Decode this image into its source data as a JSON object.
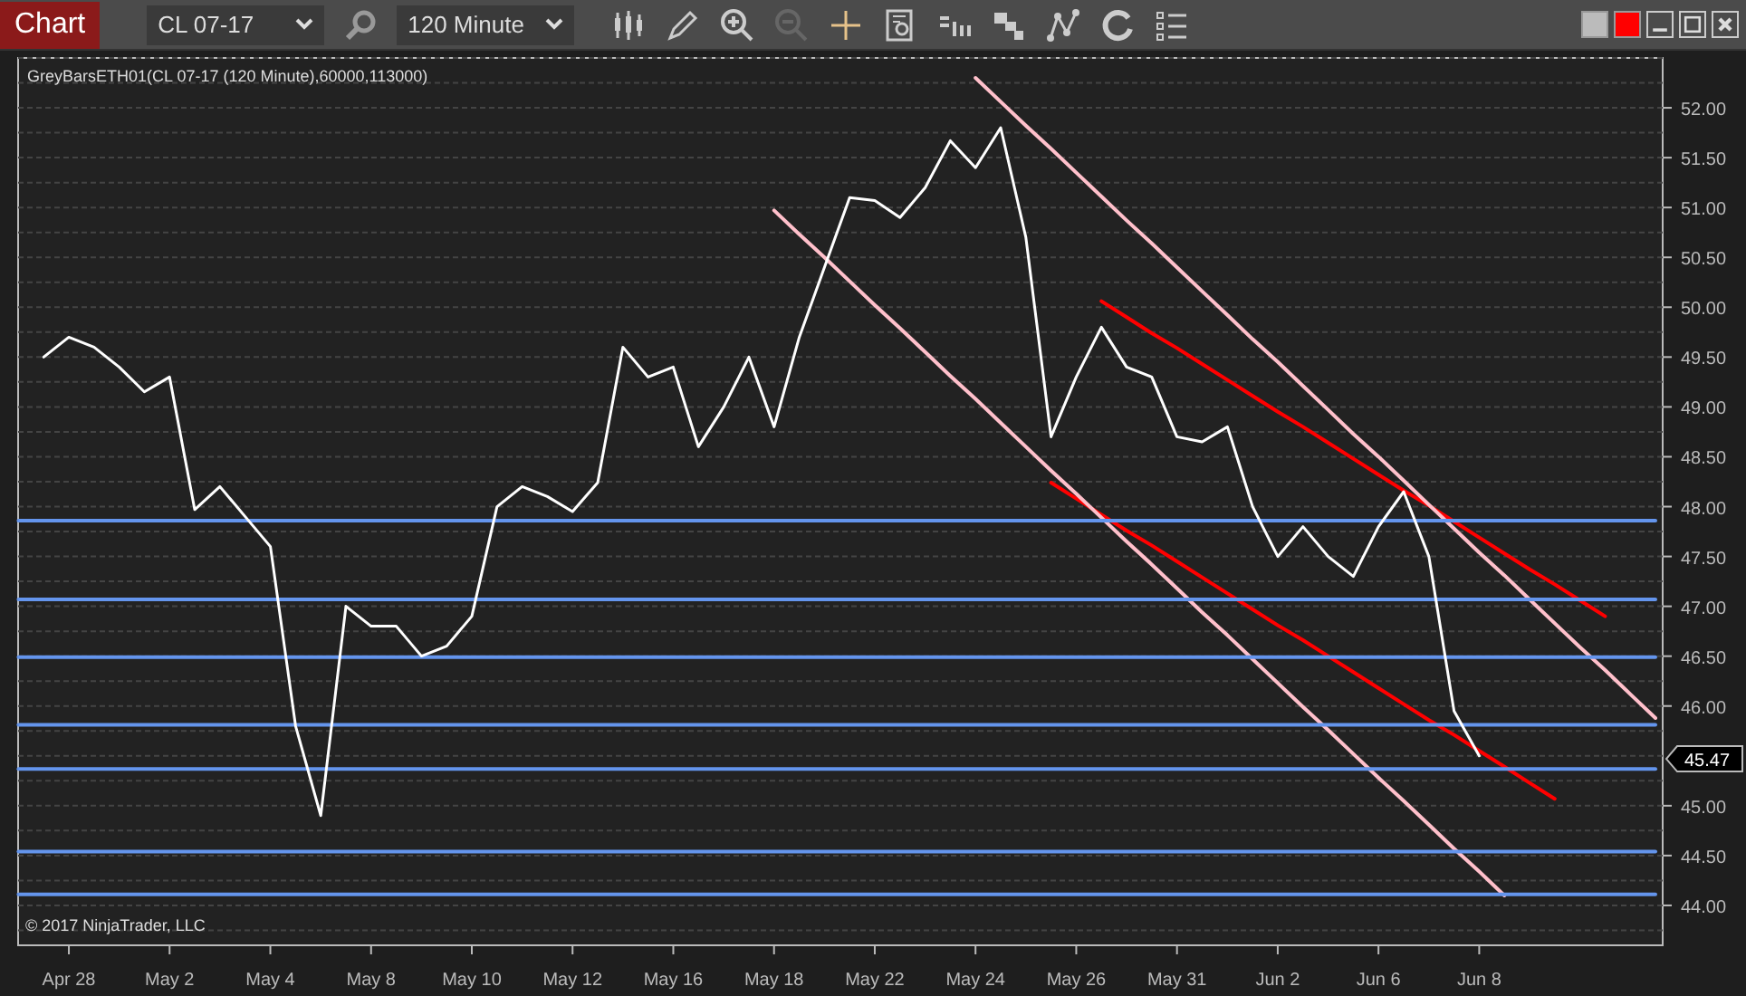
{
  "toolbar": {
    "title": "Chart",
    "instrument": "CL 07-17",
    "interval": "120 Minute"
  },
  "chart": {
    "indicator_label": "GreyBarsETH01(CL 07-17 (120 Minute),60000,113000)",
    "copyright": "© 2017 NinjaTrader, LLC",
    "last_price": "45.47",
    "chart_data": {
      "type": "line",
      "ylim": [
        43.6,
        52.5
      ],
      "categories": [
        null,
        null,
        "Apr 28",
        null,
        null,
        null,
        "May 2",
        null,
        null,
        null,
        "May 4",
        null,
        null,
        null,
        "May 8",
        null,
        null,
        null,
        "May 10",
        null,
        null,
        null,
        "May 12",
        null,
        null,
        null,
        "May 16",
        null,
        null,
        null,
        "May 18",
        null,
        null,
        null,
        "May 22",
        null,
        null,
        null,
        "May 24",
        null,
        null,
        null,
        "May 26",
        null,
        null,
        null,
        "May 31",
        null,
        null,
        null,
        "Jun 2",
        null,
        null,
        null,
        "Jun 6",
        null,
        null,
        null,
        "Jun 8",
        null,
        null,
        null,
        null,
        null,
        null,
        null
      ],
      "yticks": [
        {
          "value": 44,
          "label": "44.00"
        },
        {
          "value": 44.5,
          "label": "44.50"
        },
        {
          "value": 45,
          "label": "45.00"
        },
        {
          "value": 46,
          "label": "46.00"
        },
        {
          "value": 46.5,
          "label": "46.50"
        },
        {
          "value": 47,
          "label": "47.00"
        },
        {
          "value": 47.5,
          "label": "47.50"
        },
        {
          "value": 48,
          "label": "48.00"
        },
        {
          "value": 48.5,
          "label": "48.50"
        },
        {
          "value": 49,
          "label": "49.00"
        },
        {
          "value": 49.5,
          "label": "49.50"
        },
        {
          "value": 50,
          "label": "50.00"
        },
        {
          "value": 50.5,
          "label": "50.50"
        },
        {
          "value": 51,
          "label": "51.00"
        },
        {
          "value": 51.5,
          "label": "51.50"
        },
        {
          "value": 52,
          "label": "52.00"
        }
      ],
      "series": [
        {
          "color": "#ffffff",
          "values": [
            null,
            49.5,
            49.7,
            49.6,
            49.4,
            49.15,
            49.3,
            47.97,
            48.2,
            47.9,
            47.6,
            45.8,
            44.9,
            47.0,
            46.8,
            46.8,
            46.5,
            46.6,
            46.9,
            48.0,
            48.2,
            48.1,
            47.95,
            48.24,
            49.6,
            49.3,
            49.4,
            48.6,
            49.0,
            49.5,
            48.8,
            49.7,
            50.4,
            51.1,
            51.07,
            50.9,
            51.2,
            51.67,
            51.4,
            51.8,
            50.7,
            48.7,
            49.3,
            49.8,
            49.4,
            49.3,
            48.7,
            48.65,
            48.8,
            48.0,
            47.5,
            47.8,
            47.5,
            47.3,
            47.8,
            48.15,
            47.5,
            45.95,
            45.5,
            null,
            null,
            null,
            null,
            null,
            null,
            null
          ]
        },
        {
          "color": "#6495ed",
          "values": [
            47.86,
            47.86,
            47.86,
            47.86,
            47.86,
            47.86,
            47.86,
            47.86,
            47.86,
            47.86,
            47.86,
            47.86,
            47.86,
            47.86,
            47.86,
            47.86,
            47.86,
            47.86,
            47.86,
            47.86,
            47.86,
            47.86,
            47.86,
            47.86,
            47.86,
            47.86,
            47.86,
            47.86,
            47.86,
            47.86,
            47.86,
            47.86,
            47.86,
            47.86,
            47.86,
            47.86,
            47.86,
            47.86,
            47.86,
            47.86,
            47.86,
            47.86,
            47.86,
            47.86,
            47.86,
            47.86,
            47.86,
            47.86,
            47.86,
            47.86,
            47.86,
            47.86,
            47.86,
            47.86,
            47.86,
            47.86,
            47.86,
            47.86,
            47.86,
            47.86,
            47.86,
            47.86,
            47.86,
            47.86,
            47.86,
            47.86
          ]
        },
        {
          "color": "#6495ed",
          "values": [
            47.07,
            47.07,
            47.07,
            47.07,
            47.07,
            47.07,
            47.07,
            47.07,
            47.07,
            47.07,
            47.07,
            47.07,
            47.07,
            47.07,
            47.07,
            47.07,
            47.07,
            47.07,
            47.07,
            47.07,
            47.07,
            47.07,
            47.07,
            47.07,
            47.07,
            47.07,
            47.07,
            47.07,
            47.07,
            47.07,
            47.07,
            47.07,
            47.07,
            47.07,
            47.07,
            47.07,
            47.07,
            47.07,
            47.07,
            47.07,
            47.07,
            47.07,
            47.07,
            47.07,
            47.07,
            47.07,
            47.07,
            47.07,
            47.07,
            47.07,
            47.07,
            47.07,
            47.07,
            47.07,
            47.07,
            47.07,
            47.07,
            47.07,
            47.07,
            47.07,
            47.07,
            47.07,
            47.07,
            47.07,
            47.07,
            47.07
          ]
        },
        {
          "color": "#6495ed",
          "values": [
            46.49,
            46.49,
            46.49,
            46.49,
            46.49,
            46.49,
            46.49,
            46.49,
            46.49,
            46.49,
            46.49,
            46.49,
            46.49,
            46.49,
            46.49,
            46.49,
            46.49,
            46.49,
            46.49,
            46.49,
            46.49,
            46.49,
            46.49,
            46.49,
            46.49,
            46.49,
            46.49,
            46.49,
            46.49,
            46.49,
            46.49,
            46.49,
            46.49,
            46.49,
            46.49,
            46.49,
            46.49,
            46.49,
            46.49,
            46.49,
            46.49,
            46.49,
            46.49,
            46.49,
            46.49,
            46.49,
            46.49,
            46.49,
            46.49,
            46.49,
            46.49,
            46.49,
            46.49,
            46.49,
            46.49,
            46.49,
            46.49,
            46.49,
            46.49,
            46.49,
            46.49,
            46.49,
            46.49,
            46.49,
            46.49,
            46.49
          ]
        },
        {
          "color": "#6495ed",
          "values": [
            45.81,
            45.81,
            45.81,
            45.81,
            45.81,
            45.81,
            45.81,
            45.81,
            45.81,
            45.81,
            45.81,
            45.81,
            45.81,
            45.81,
            45.81,
            45.81,
            45.81,
            45.81,
            45.81,
            45.81,
            45.81,
            45.81,
            45.81,
            45.81,
            45.81,
            45.81,
            45.81,
            45.81,
            45.81,
            45.81,
            45.81,
            45.81,
            45.81,
            45.81,
            45.81,
            45.81,
            45.81,
            45.81,
            45.81,
            45.81,
            45.81,
            45.81,
            45.81,
            45.81,
            45.81,
            45.81,
            45.81,
            45.81,
            45.81,
            45.81,
            45.81,
            45.81,
            45.81,
            45.81,
            45.81,
            45.81,
            45.81,
            45.81,
            45.81,
            45.81,
            45.81,
            45.81,
            45.81,
            45.81,
            45.81,
            45.81
          ]
        },
        {
          "color": "#6495ed",
          "values": [
            45.37,
            45.37,
            45.37,
            45.37,
            45.37,
            45.37,
            45.37,
            45.37,
            45.37,
            45.37,
            45.37,
            45.37,
            45.37,
            45.37,
            45.37,
            45.37,
            45.37,
            45.37,
            45.37,
            45.37,
            45.37,
            45.37,
            45.37,
            45.37,
            45.37,
            45.37,
            45.37,
            45.37,
            45.37,
            45.37,
            45.37,
            45.37,
            45.37,
            45.37,
            45.37,
            45.37,
            45.37,
            45.37,
            45.37,
            45.37,
            45.37,
            45.37,
            45.37,
            45.37,
            45.37,
            45.37,
            45.37,
            45.37,
            45.37,
            45.37,
            45.37,
            45.37,
            45.37,
            45.37,
            45.37,
            45.37,
            45.37,
            45.37,
            45.37,
            45.37,
            45.37,
            45.37,
            45.37,
            45.37,
            45.37,
            45.37
          ]
        },
        {
          "color": "#6495ed",
          "values": [
            44.54,
            44.54,
            44.54,
            44.54,
            44.54,
            44.54,
            44.54,
            44.54,
            44.54,
            44.54,
            44.54,
            44.54,
            44.54,
            44.54,
            44.54,
            44.54,
            44.54,
            44.54,
            44.54,
            44.54,
            44.54,
            44.54,
            44.54,
            44.54,
            44.54,
            44.54,
            44.54,
            44.54,
            44.54,
            44.54,
            44.54,
            44.54,
            44.54,
            44.54,
            44.54,
            44.54,
            44.54,
            44.54,
            44.54,
            44.54,
            44.54,
            44.54,
            44.54,
            44.54,
            44.54,
            44.54,
            44.54,
            44.54,
            44.54,
            44.54,
            44.54,
            44.54,
            44.54,
            44.54,
            44.54,
            44.54,
            44.54,
            44.54,
            44.54,
            44.54,
            44.54,
            44.54,
            44.54,
            44.54,
            44.54,
            44.54
          ]
        },
        {
          "color": "#6495ed",
          "values": [
            44.11,
            44.11,
            44.11,
            44.11,
            44.11,
            44.11,
            44.11,
            44.11,
            44.11,
            44.11,
            44.11,
            44.11,
            44.11,
            44.11,
            44.11,
            44.11,
            44.11,
            44.11,
            44.11,
            44.11,
            44.11,
            44.11,
            44.11,
            44.11,
            44.11,
            44.11,
            44.11,
            44.11,
            44.11,
            44.11,
            44.11,
            44.11,
            44.11,
            44.11,
            44.11,
            44.11,
            44.11,
            44.11,
            44.11,
            44.11,
            44.11,
            44.11,
            44.11,
            44.11,
            44.11,
            44.11,
            44.11,
            44.11,
            44.11,
            44.11,
            44.11,
            44.11,
            44.11,
            44.11,
            44.11,
            44.11,
            44.11,
            44.11,
            44.11,
            44.11,
            44.11,
            44.11,
            44.11,
            44.11,
            44.11,
            44.11
          ]
        },
        {
          "color": "#ffc0cb",
          "values": [
            null,
            null,
            null,
            null,
            null,
            null,
            null,
            null,
            null,
            null,
            null,
            null,
            null,
            null,
            null,
            null,
            null,
            null,
            null,
            null,
            null,
            null,
            null,
            null,
            null,
            null,
            null,
            null,
            null,
            null,
            50.97,
            50.73,
            50.5,
            50.26,
            50.02,
            49.79,
            49.55,
            49.31,
            49.08,
            48.84,
            48.6,
            48.36,
            48.13,
            47.89,
            47.65,
            47.42,
            47.18,
            46.94,
            46.71,
            46.47,
            46.23,
            45.99,
            45.76,
            45.52,
            45.28,
            45.05,
            44.81,
            44.57,
            44.34,
            44.1,
            null,
            null,
            null,
            null,
            null,
            null
          ]
        },
        {
          "color": "#ffc0cb",
          "values": [
            null,
            null,
            null,
            null,
            null,
            null,
            null,
            null,
            null,
            null,
            null,
            null,
            null,
            null,
            null,
            null,
            null,
            null,
            null,
            null,
            null,
            null,
            null,
            null,
            null,
            null,
            null,
            null,
            null,
            null,
            null,
            null,
            null,
            null,
            null,
            null,
            null,
            null,
            52.3,
            52.06,
            51.82,
            51.59,
            51.35,
            51.11,
            50.87,
            50.64,
            50.4,
            50.16,
            49.92,
            49.68,
            49.45,
            49.21,
            48.97,
            48.73,
            48.5,
            48.26,
            48.02,
            47.78,
            47.54,
            47.31,
            47.07,
            46.83,
            46.59,
            46.36,
            46.12,
            45.88
          ]
        },
        {
          "color": "#ff0000",
          "values": [
            null,
            null,
            null,
            null,
            null,
            null,
            null,
            null,
            null,
            null,
            null,
            null,
            null,
            null,
            null,
            null,
            null,
            null,
            null,
            null,
            null,
            null,
            null,
            null,
            null,
            null,
            null,
            null,
            null,
            null,
            null,
            null,
            null,
            null,
            null,
            null,
            null,
            null,
            null,
            null,
            null,
            null,
            null,
            50.06,
            49.9,
            49.74,
            49.59,
            49.43,
            49.27,
            49.11,
            48.95,
            48.8,
            48.64,
            48.48,
            48.32,
            48.16,
            48.01,
            47.85,
            47.69,
            47.53,
            47.37,
            47.22,
            47.06,
            46.9,
            null,
            null
          ]
        },
        {
          "color": "#ff0000",
          "values": [
            null,
            null,
            null,
            null,
            null,
            null,
            null,
            null,
            null,
            null,
            null,
            null,
            null,
            null,
            null,
            null,
            null,
            null,
            null,
            null,
            null,
            null,
            null,
            null,
            null,
            null,
            null,
            null,
            null,
            null,
            null,
            null,
            null,
            null,
            null,
            null,
            null,
            null,
            null,
            null,
            null,
            48.24,
            48.08,
            47.92,
            47.76,
            47.61,
            47.45,
            47.29,
            47.13,
            46.97,
            46.81,
            46.66,
            46.5,
            46.34,
            46.18,
            46.02,
            45.86,
            45.71,
            45.55,
            45.39,
            45.23,
            45.07,
            null,
            null,
            null,
            null
          ]
        }
      ],
      "grid": true
    }
  }
}
